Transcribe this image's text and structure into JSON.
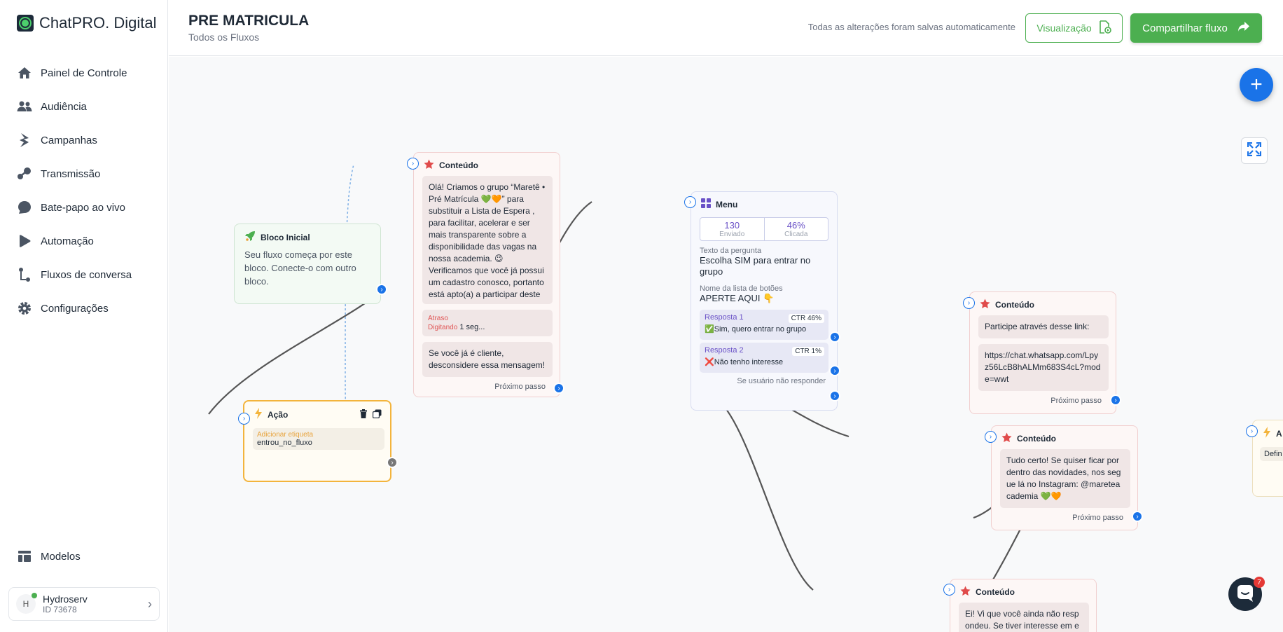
{
  "brand": {
    "name": "ChatPRO. Digital"
  },
  "nav": {
    "items": [
      {
        "label": "Painel de Controle",
        "icon": "home-icon"
      },
      {
        "label": "Audiência",
        "icon": "users-icon"
      },
      {
        "label": "Campanhas",
        "icon": "bolt-icon"
      },
      {
        "label": "Transmissão",
        "icon": "broadcast-icon"
      },
      {
        "label": "Bate-papo ao vivo",
        "icon": "chat-bubble-icon"
      },
      {
        "label": "Automação",
        "icon": "play-icon"
      },
      {
        "label": "Fluxos de conversa",
        "icon": "flow-icon"
      },
      {
        "label": "Configurações",
        "icon": "gear-icon"
      }
    ],
    "bottom": {
      "label": "Modelos",
      "icon": "templates-icon"
    }
  },
  "account": {
    "initial": "H",
    "name": "Hydroserv",
    "id": "ID 73678"
  },
  "header": {
    "title": "PRE MATRICULA",
    "subtitle": "Todos os Fluxos",
    "saved_status": "Todas as alterações foram salvas automaticamente",
    "preview_label": "Visualização",
    "share_label": "Compartilhar fluxo"
  },
  "canvas": {
    "chat_badge_count": "7",
    "start_node": {
      "title": "Bloco Inicial",
      "description": "Seu fluxo começa por este bloco. Conecte-o com outro bloco."
    },
    "action_node": {
      "title": "Ação",
      "tag_label": "Adicionar etiqueta",
      "tag_value": "entrou_no_fluxo"
    },
    "content_node_1": {
      "title": "Conteúdo",
      "message": "Olá! Criamos o grupo “Maretê • Pré Matrícula 💚🧡” para substituir a Lista de Espera , para facilitar, acelerar e ser mais transparente sobre a disponibilidade das vagas na nossa academia. 😉 Verificamos que você já possui um cadastro conosco, portanto está apto(a) a participar deste grupo.",
      "delay_label": "Atraso",
      "delay_type": "Digitando",
      "delay_value": "1 seg...",
      "message2": "Se você já é cliente, desconsidere essa mensagem!",
      "next_step": "Próximo passo"
    },
    "menu_node": {
      "title": "Menu",
      "sent_value": "130",
      "sent_label": "Enviado",
      "clicked_value": "46%",
      "clicked_label": "Clicada",
      "question_label": "Texto da pergunta",
      "question_value": "Escolha SIM para entrar no grupo",
      "button_list_label": "Nome da lista de botões",
      "button_list_value": "APERTE AQUI 👇",
      "answers": [
        {
          "label": "Resposta 1",
          "ctr": "CTR 46%",
          "text": "✅Sim, quero entrar no grupo"
        },
        {
          "label": "Resposta 2",
          "ctr": "CTR 1%",
          "text": "❌Não tenho interesse"
        }
      ],
      "no_reply": "Se usuário não responder"
    },
    "content_node_2": {
      "title": "Conteúdo",
      "message": "Participe através desse link:",
      "link": "https://chat.whatsapp.com/Lpyz56LcB8hALMm683S4cL?mode=wwt",
      "next_step": "Próximo passo"
    },
    "content_node_3": {
      "title": "Conteúdo",
      "message": "Tudo certo! Se quiser ficar por dentro das novidades, nos segue lá no Instagram: @mareteacademia  💚🧡",
      "next_step": "Próximo passo"
    },
    "content_node_4": {
      "title": "Conteúdo",
      "message": "Ei! Vi que você ainda não respondeu. Se tiver interesse em e"
    },
    "partial_node": {
      "title": "A",
      "text": "Defin"
    }
  },
  "colors": {
    "accent_green": "#4caf50",
    "accent_blue": "#1a73e8",
    "content_red": "#e04b4b",
    "action_orange": "#f3b43c",
    "menu_purple": "#6a51c7"
  }
}
